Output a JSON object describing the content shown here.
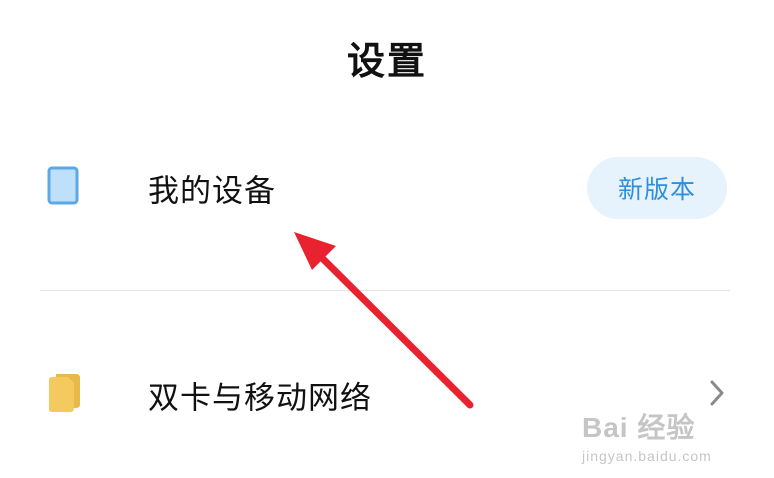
{
  "header": {
    "title": "设置"
  },
  "settings": {
    "items": [
      {
        "label": "我的设备",
        "icon": "device-icon",
        "badge": "新版本",
        "icon_color": "#5aa9e6",
        "icon_fill": "#bfe0fa"
      },
      {
        "label": "双卡与移动网络",
        "icon": "sim-cards-icon",
        "icon_color": "#f4c95d",
        "chevron": "chevron-right-icon"
      }
    ]
  },
  "colors": {
    "badge_bg": "#e6f3fd",
    "badge_text": "#2f8fdc",
    "arrow": "#e8232f",
    "divider": "#e4e4e4"
  },
  "watermark": {
    "brand": "Bai 经验",
    "url": "jingyan.baidu.com"
  }
}
